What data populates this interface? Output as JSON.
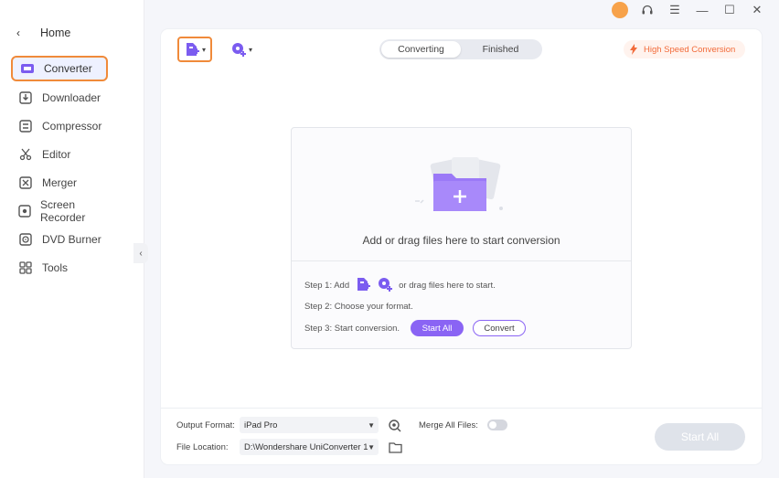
{
  "sidebar": {
    "home_label": "Home",
    "items": [
      {
        "label": "Converter",
        "icon": "converter-icon"
      },
      {
        "label": "Downloader",
        "icon": "downloader-icon"
      },
      {
        "label": "Compressor",
        "icon": "compressor-icon"
      },
      {
        "label": "Editor",
        "icon": "scissors-icon"
      },
      {
        "label": "Merger",
        "icon": "merger-icon"
      },
      {
        "label": "Screen Recorder",
        "icon": "screen-recorder-icon"
      },
      {
        "label": "DVD Burner",
        "icon": "dvd-icon"
      },
      {
        "label": "Tools",
        "icon": "tools-icon"
      }
    ],
    "active_item": "Converter"
  },
  "tabs": {
    "converting": "Converting",
    "finished": "Finished",
    "active": "Converting"
  },
  "high_speed": "High Speed Conversion",
  "dropzone": {
    "text": "Add or drag files here to start conversion",
    "step1_prefix": "Step 1: Add",
    "step1_suffix": "or drag files here to start.",
    "step2": "Step 2: Choose your format.",
    "step3": "Step 3: Start conversion.",
    "start_all": "Start All",
    "convert": "Convert"
  },
  "bottom": {
    "output_format_label": "Output Format:",
    "output_format_value": "iPad Pro",
    "merge_label": "Merge All Files:",
    "merge_enabled": false,
    "file_location_label": "File Location:",
    "file_location_value": "D:\\Wondershare UniConverter 1",
    "start_all": "Start All"
  },
  "colors": {
    "accent": "#8a64f4",
    "highlight_border": "#f08a3a",
    "high_speed": "#f26b3a"
  }
}
